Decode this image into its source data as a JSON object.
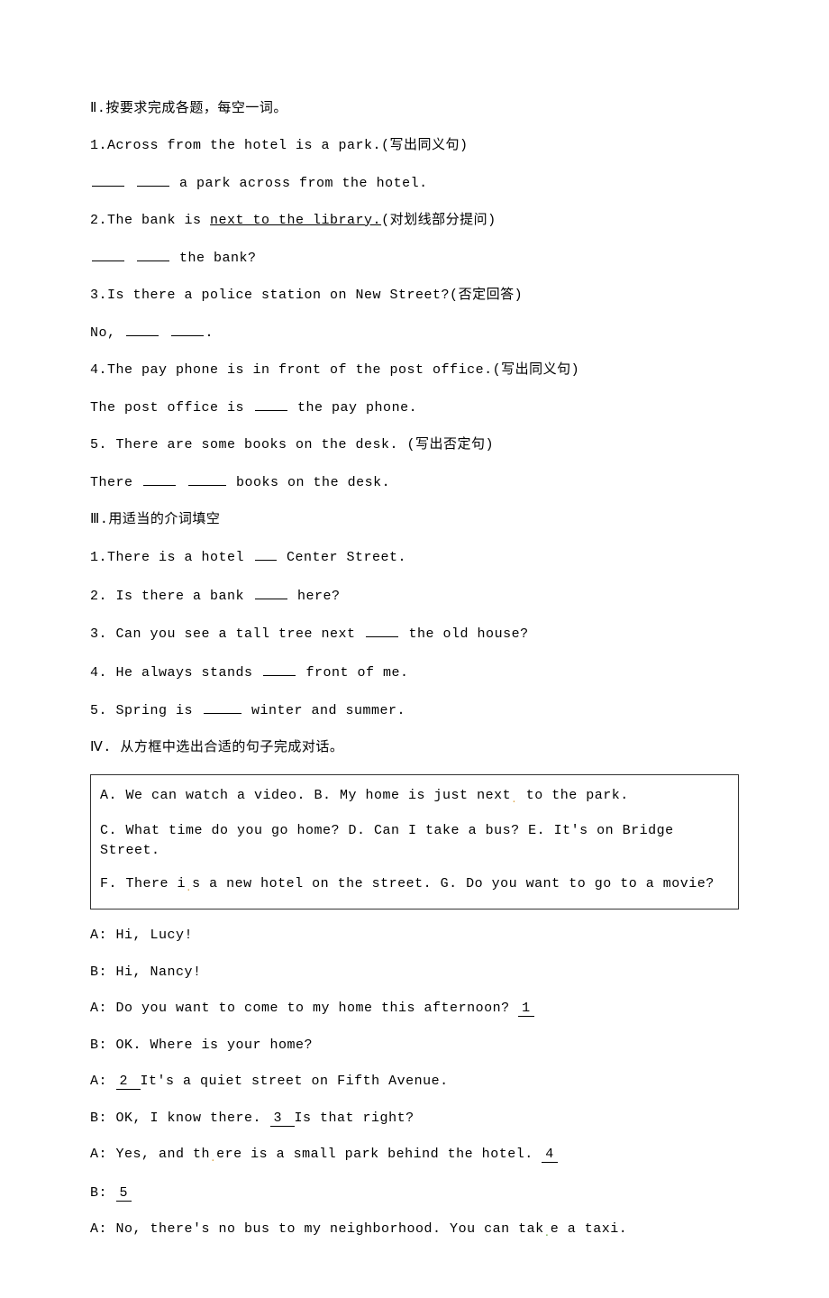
{
  "section2": {
    "title": "Ⅱ.按要求完成各题，每空一词。",
    "q1a": "1.Across from the hotel is a park.(写出同义句)",
    "q1b_suffix": " a park across from the hotel.",
    "q2a_prefix": "2.The bank is ",
    "q2a_underlined": "next to the library.",
    "q2a_suffix": "(对划线部分提问)",
    "q2b_suffix": " the bank?",
    "q3a": "3.Is there a police station on New Street?(否定回答)",
    "q3b_prefix": "No, ",
    "q3b_period": ".",
    "q4a": "4.The pay phone is in front of the post office.(写出同义句)",
    "q4b_prefix": "The post office is ",
    "q4b_suffix": " the pay phone.",
    "q5a": "5. There are some books on the desk. (写出否定句)",
    "q5b_prefix": "There ",
    "q5b_suffix": " books on the desk."
  },
  "section3": {
    "title": "Ⅲ.用适当的介词填空",
    "q1_prefix": "1.There is a hotel ",
    "q1_suffix": " Center Street.",
    "q2_prefix": "2. Is there a bank ",
    "q2_suffix": " here?",
    "q3_prefix": "3. Can you see a tall tree next ",
    "q3_suffix": " the old house?",
    "q4_prefix": "4. He always stands ",
    "q4_suffix": " front of me.",
    "q5_prefix": "5. Spring is ",
    "q5_suffix": " winter and summer."
  },
  "section4": {
    "title": "Ⅳ. 从方框中选出合适的句子完成对话。",
    "box_line1_a": "A. We can watch a video.   B. My home is just next",
    "box_line1_b": " to the park.",
    "box_line2": "C. What time do you go home?  D. Can I take a bus?   E. It's on Bridge Street.",
    "box_line3_a": "F. There i",
    "box_line3_b": "s a new hotel on the street. G. Do you want to go to a movie?",
    "d1": "A: Hi, Lucy!",
    "d2": "B: Hi, Nancy!",
    "d3_prefix": "A: Do you want to come to my home this afternoon? ",
    "d3_blank": " 1 ",
    "d4": "B: OK. Where is your home?",
    "d5_prefix": "A: ",
    "d5_blank": " 2 ",
    "d5_suffix": " It's a quiet street on Fifth Avenue.",
    "d6_prefix": "B: OK, I know there. ",
    "d6_blank": " 3 ",
    "d6_suffix": " Is that right?",
    "d7_prefix_a": "A: Yes, and th",
    "d7_prefix_b": "ere is a small park behind the hotel. ",
    "d7_blank": " 4 ",
    "d8_prefix": "B: ",
    "d8_blank": " 5 ",
    "d9_prefix": "A: No, there's no bus to my neighborhood. You can tak",
    "d9_suffix": "e a taxi."
  }
}
